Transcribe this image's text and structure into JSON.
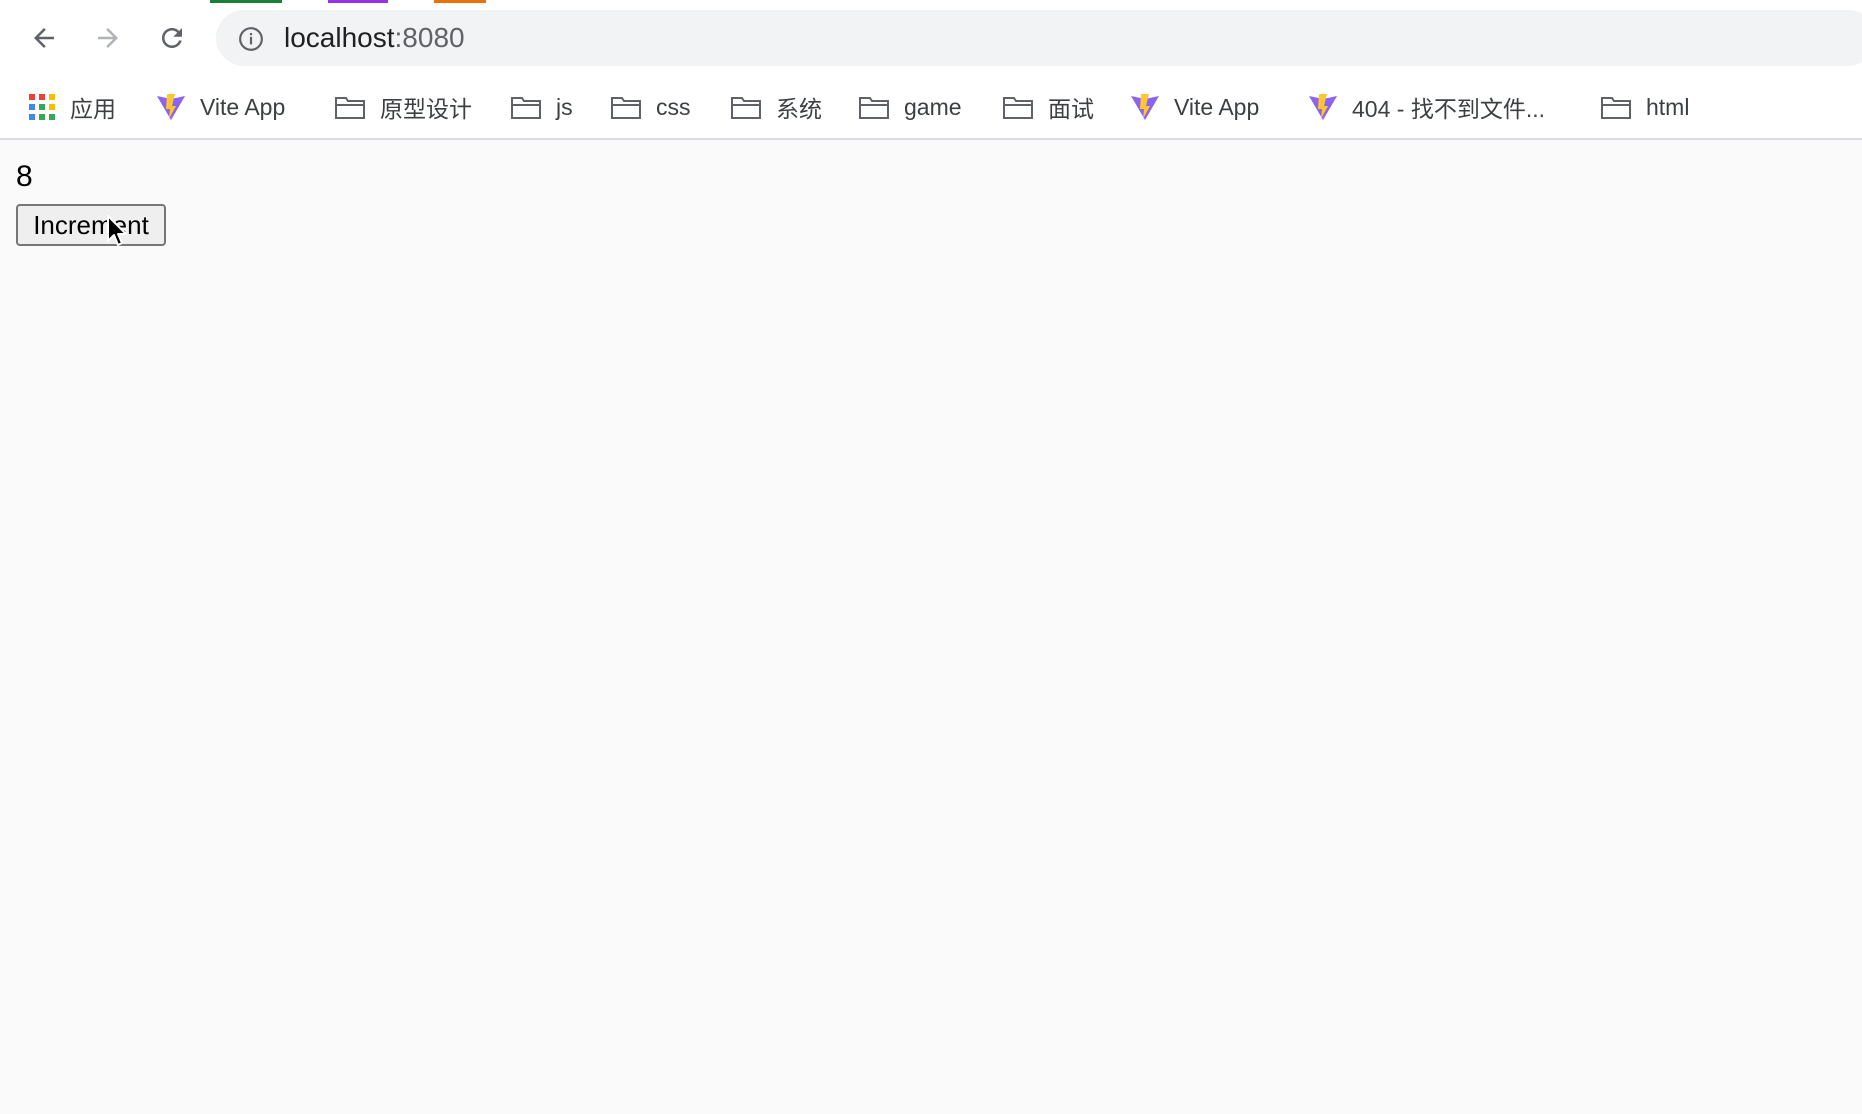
{
  "browser": {
    "tab_accent_colors": [
      "#188038",
      "#9334e6",
      "#e8710a"
    ],
    "address_bar": {
      "host": "localhost",
      "port": ":8080"
    },
    "nav": {
      "back_icon": "arrow-left-icon",
      "forward_icon": "arrow-right-icon",
      "reload_icon": "reload-icon",
      "site_info_icon": "info-icon"
    },
    "bookmarks": [
      {
        "label": "应用",
        "icon": "apps-grid-icon"
      },
      {
        "label": "Vite App",
        "icon": "vite-logo-icon"
      },
      {
        "label": "原型设计",
        "icon": "folder-icon"
      },
      {
        "label": "js",
        "icon": "folder-icon"
      },
      {
        "label": "css",
        "icon": "folder-icon"
      },
      {
        "label": "系统",
        "icon": "folder-icon"
      },
      {
        "label": "game",
        "icon": "folder-icon"
      },
      {
        "label": "面试",
        "icon": "folder-icon"
      },
      {
        "label": "Vite App",
        "icon": "vite-logo-icon"
      },
      {
        "label": "404 - 找不到文件...",
        "icon": "vite-logo-icon"
      },
      {
        "label": "html",
        "icon": "folder-icon"
      }
    ]
  },
  "page": {
    "count": "8",
    "increment_label": "Increment"
  }
}
